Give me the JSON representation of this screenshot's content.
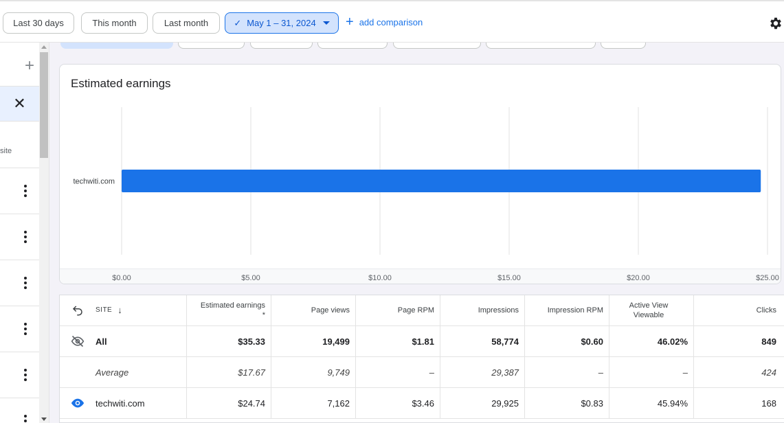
{
  "filters": {
    "chips": [
      "Last 30 days",
      "This month",
      "Last month"
    ],
    "selected_range": "May 1 – 31, 2024",
    "add_comparison": "add comparison"
  },
  "leftrail": {
    "site_label": "site"
  },
  "chart": {
    "title": "Estimated earnings"
  },
  "chart_data": {
    "type": "bar",
    "orientation": "horizontal",
    "title": "Estimated earnings",
    "categories": [
      "techwiti.com"
    ],
    "values": [
      24.74
    ],
    "xlim": [
      0,
      25
    ],
    "x_ticks": [
      "$0.00",
      "$5.00",
      "$10.00",
      "$15.00",
      "$20.00",
      "$25.00"
    ],
    "grid": true,
    "bar_color": "#1a73e8"
  },
  "table": {
    "headers": {
      "site": "SITE",
      "earnings": "Estimated earnings",
      "earnings_note": "*",
      "page_views": "Page views",
      "page_rpm": "Page RPM",
      "impressions": "Impressions",
      "impression_rpm": "Impression RPM",
      "active_view_1": "Active View",
      "active_view_2": "Viewable",
      "clicks": "Clicks"
    },
    "rows": [
      {
        "site": "All",
        "earnings": "$35.33",
        "page_views": "19,499",
        "page_rpm": "$1.81",
        "impressions": "58,774",
        "impression_rpm": "$0.60",
        "active_view": "46.02%",
        "clicks": "849"
      },
      {
        "site": "Average",
        "earnings": "$17.67",
        "page_views": "9,749",
        "page_rpm": "–",
        "impressions": "29,387",
        "impression_rpm": "–",
        "active_view": "–",
        "clicks": "424"
      },
      {
        "site": "techwiti.com",
        "earnings": "$24.74",
        "page_views": "7,162",
        "page_rpm": "$3.46",
        "impressions": "29,925",
        "impression_rpm": "$0.83",
        "active_view": "45.94%",
        "clicks": "168"
      }
    ]
  }
}
